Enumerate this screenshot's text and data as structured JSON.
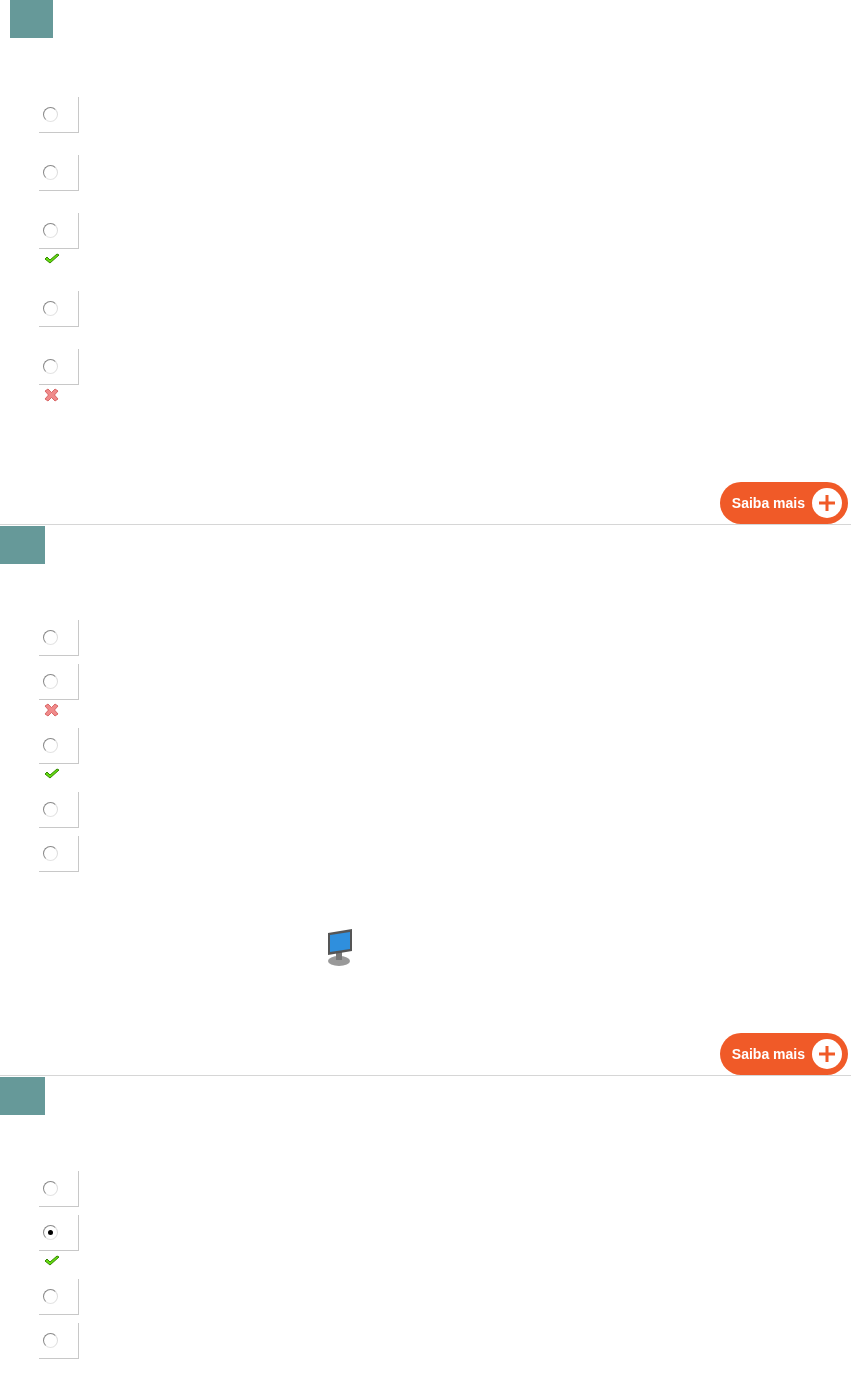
{
  "questions": [
    {
      "kind": "plain",
      "options": [
        {
          "selected": false,
          "kind": "plain"
        },
        {
          "selected": false,
          "kind": "plain"
        },
        {
          "selected": false,
          "kind": "correct"
        },
        {
          "selected": false,
          "kind": "plain"
        },
        {
          "selected": false,
          "kind": "wrong"
        }
      ],
      "button": "Saiba mais"
    },
    {
      "kind": "with-icon",
      "options": [
        {
          "selected": false,
          "kind": "plain"
        },
        {
          "selected": false,
          "kind": "wrong"
        },
        {
          "selected": false,
          "kind": "correct"
        },
        {
          "selected": false,
          "kind": "plain"
        },
        {
          "selected": false,
          "kind": "plain"
        }
      ],
      "button": "Saiba mais"
    },
    {
      "kind": "plain",
      "options": [
        {
          "selected": false,
          "kind": "plain"
        },
        {
          "selected": true,
          "kind": "correct"
        },
        {
          "selected": false,
          "kind": "plain"
        },
        {
          "selected": false,
          "kind": "plain"
        }
      ]
    }
  ]
}
